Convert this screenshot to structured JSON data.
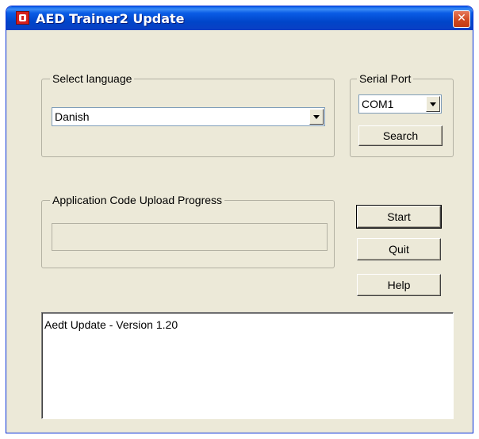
{
  "window": {
    "title": "AED Trainer2 Update",
    "close_glyph": "✕"
  },
  "language": {
    "group_label": "Select language",
    "selected": "Danish"
  },
  "serial_port": {
    "group_label": "Serial Port",
    "selected": "COM1",
    "search_label": "Search"
  },
  "progress": {
    "group_label": "Application Code Upload Progress",
    "value_percent": 0
  },
  "buttons": {
    "start_label": "Start",
    "quit_label": "Quit",
    "help_label": "Help"
  },
  "log": {
    "lines": [
      "Aedt Update - Version 1.20"
    ]
  },
  "colors": {
    "titlebar": "#0a5ce6",
    "face": "#ece9d8",
    "close": "#d04a21",
    "progress_fill": "#2ec637"
  },
  "icons": {
    "app": "aed-app-icon",
    "close": "close-icon",
    "dropdown": "chevron-down-icon"
  }
}
